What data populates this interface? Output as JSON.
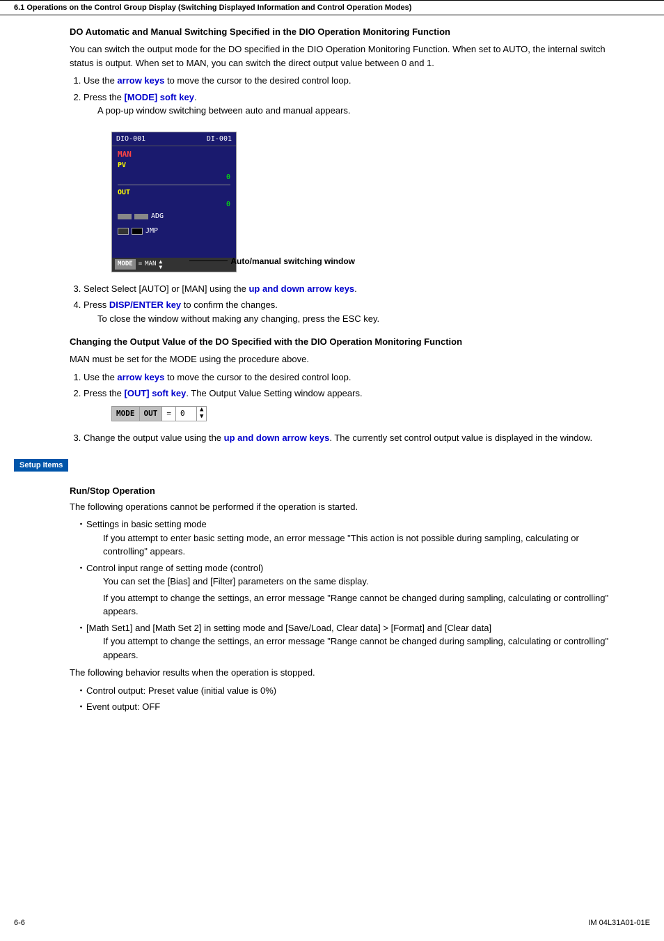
{
  "header": {
    "text": "6.1  Operations on the Control Group Display (Switching Displayed Information and Control Operation Modes)"
  },
  "section1": {
    "title": "DO Automatic and Manual Switching Specified in the DIO Operation Monitoring Function",
    "para1": "You can switch the output mode for the DO specified in the DIO Operation Monitoring Function.  When set to AUTO, the internal switch status is output.  When set to MAN, you can switch the direct output value between 0 and 1.",
    "step1": "Use the ",
    "step1_link": "arrow keys",
    "step1_end": " to move the cursor to the desired control loop.",
    "step2": "Press the ",
    "step2_link": "[MODE] soft key",
    "step2_end": ".",
    "step2_sub": "A pop-up window switching between auto and manual appears.",
    "dio_window": {
      "title_left": "DIO-001",
      "title_right": "DI-001",
      "man_label": "MAN",
      "pv_label": "PV",
      "pv_value": "0",
      "out_label": "OUT",
      "out_value": "0",
      "adg_label": "ADG",
      "jmp_label": "JMP",
      "mode_btn": "MODE",
      "eq_label": "=",
      "man_val": "MAN",
      "auto_manual_label": "Auto/manual switching window"
    },
    "step3": "Select Select [AUTO] or [MAN] using the ",
    "step3_link": "up and down arrow keys",
    "step3_end": ".",
    "step4": "Press ",
    "step4_link": "DISP/ENTER key",
    "step4_end": " to confirm the changes.",
    "step4_sub": "To close the window without making any changing, press the ESC key."
  },
  "section2": {
    "title": "Changing the Output Value of the DO Specified with the DIO Operation Monitoring Function",
    "para1": "MAN must be set for the MODE using the procedure above.",
    "step1": "Use the ",
    "step1_link": "arrow keys",
    "step1_end": " to move the cursor to the desired control loop.",
    "step2": "Press the ",
    "step2_link": "[OUT] soft key",
    "step2_end": ".  The Output Value Setting window appears.",
    "mode_bar": {
      "mode": "MODE",
      "out": "OUT",
      "eq": "=",
      "val": "0"
    },
    "step3": "Change the output value using the ",
    "step3_link": "up and down arrow keys",
    "step3_end": ".  The currently set control output value is displayed in the window."
  },
  "setup_items": {
    "badge_label": "Setup Items",
    "subsection_title": "Run/Stop Operation",
    "para1": "The following operations cannot be performed if the operation is started.",
    "bullets": [
      {
        "main": "Settings in basic setting mode",
        "sub": "If you attempt to enter basic setting mode, an error message “This action is not possible during sampling, calculating or controlling” appears."
      },
      {
        "main": "Control input range of setting mode (control)",
        "sub": "You can set the [Bias] and [Filter] parameters on the same display.\nIf you attempt to change the settings, an error message “Range cannot be changed during sampling, calculating or controlling” appears."
      },
      {
        "main": "[Math Set1] and [Math Set 2] in setting mode and [Save/Load, Clear data] > [Format] and [Clear data]",
        "sub": "If you attempt to change the settings, an error message “Range cannot be changed during sampling, calculating or controlling” appears."
      }
    ],
    "para2": "The following behavior results when the operation is stopped.",
    "bullets2": [
      "Control output: Preset value (initial value is 0%)",
      "Event output: OFF"
    ]
  },
  "footer": {
    "left": "6-6",
    "right": "IM 04L31A01-01E"
  }
}
